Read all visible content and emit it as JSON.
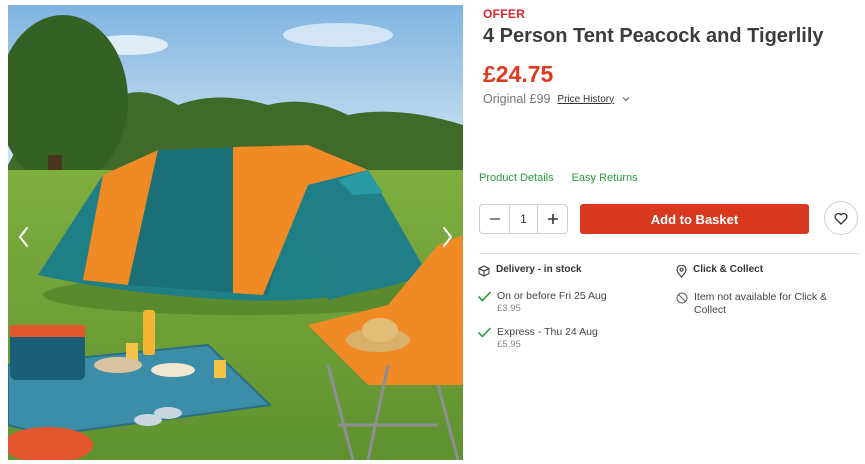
{
  "product": {
    "badge": "OFFER",
    "title": "4 Person Tent Peacock and Tigerlily",
    "price": "£24.75",
    "original": "Original £99",
    "price_history": "Price History"
  },
  "links": {
    "product_details": "Product Details",
    "easy_returns": "Easy Returns"
  },
  "quantity": {
    "value": "1"
  },
  "basket": {
    "label": "Add to Basket"
  },
  "delivery": {
    "heading": "Delivery - in stock",
    "options": [
      {
        "label": "On or before Fri 25 Aug",
        "price": "£3.95"
      },
      {
        "label": "Express - Thu 24 Aug",
        "price": "£5.95"
      }
    ]
  },
  "collect": {
    "heading": "Click & Collect",
    "note_line1": "Item not available for Click &",
    "note_line2": "Collect"
  },
  "colors": {
    "accent_red": "#d8381e",
    "success_green": "#2e9a3e",
    "tent_teal": "#1f7f87",
    "tent_orange": "#f08a24"
  },
  "icons": [
    "chevron-left-icon",
    "chevron-right-icon",
    "chevron-down-icon",
    "minus-icon",
    "plus-icon",
    "heart-icon",
    "box-icon",
    "location-pin-icon",
    "check-icon",
    "unavailable-icon"
  ]
}
